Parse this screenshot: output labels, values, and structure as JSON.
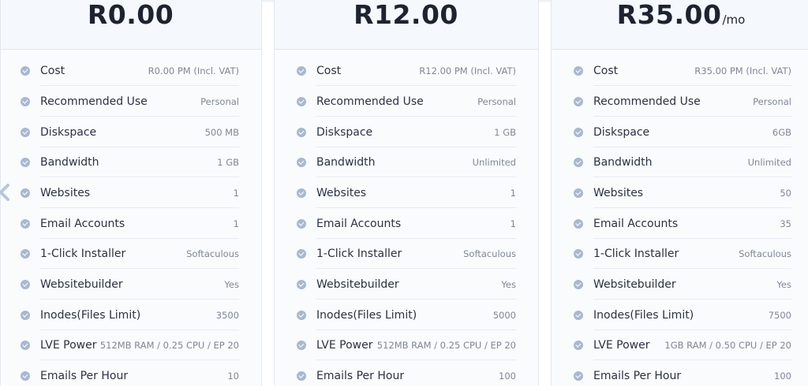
{
  "plans": [
    {
      "price": "R0.00",
      "per": "",
      "features": [
        {
          "label": "Cost",
          "value": "R0.00 PM (Incl. VAT)"
        },
        {
          "label": "Recommended Use",
          "value": "Personal"
        },
        {
          "label": "Diskspace",
          "value": "500 MB"
        },
        {
          "label": "Bandwidth",
          "value": "1 GB"
        },
        {
          "label": "Websites",
          "value": "1"
        },
        {
          "label": "Email Accounts",
          "value": "1"
        },
        {
          "label": "1-Click Installer",
          "value": "Softaculous"
        },
        {
          "label": "Websitebuilder",
          "value": "Yes"
        },
        {
          "label": "Inodes(Files Limit)",
          "value": "3500"
        },
        {
          "label": "LVE Power",
          "value": "512MB RAM / 0.25 CPU / EP 20"
        },
        {
          "label": "Emails Per Hour",
          "value": "10"
        }
      ]
    },
    {
      "price": "R12.00",
      "per": "",
      "features": [
        {
          "label": "Cost",
          "value": "R12.00 PM (Incl. VAT)"
        },
        {
          "label": "Recommended Use",
          "value": "Personal"
        },
        {
          "label": "Diskspace",
          "value": "1 GB"
        },
        {
          "label": "Bandwidth",
          "value": "Unlimited"
        },
        {
          "label": "Websites",
          "value": "1"
        },
        {
          "label": "Email Accounts",
          "value": "1"
        },
        {
          "label": "1-Click Installer",
          "value": "Softaculous"
        },
        {
          "label": "Websitebuilder",
          "value": "Yes"
        },
        {
          "label": "Inodes(Files Limit)",
          "value": "5000"
        },
        {
          "label": "LVE Power",
          "value": "512MB RAM / 0.25 CPU / EP 20"
        },
        {
          "label": "Emails Per Hour",
          "value": "100"
        }
      ]
    },
    {
      "price": "R35.00",
      "per": "/mo",
      "features": [
        {
          "label": "Cost",
          "value": "R35.00 PM (Incl. VAT)"
        },
        {
          "label": "Recommended Use",
          "value": "Personal"
        },
        {
          "label": "Diskspace",
          "value": "6GB"
        },
        {
          "label": "Bandwidth",
          "value": "Unlimited"
        },
        {
          "label": "Websites",
          "value": "50"
        },
        {
          "label": "Email Accounts",
          "value": "35"
        },
        {
          "label": "1-Click Installer",
          "value": "Softaculous"
        },
        {
          "label": "Websitebuilder",
          "value": "Yes"
        },
        {
          "label": "Inodes(Files Limit)",
          "value": "7500"
        },
        {
          "label": "LVE Power",
          "value": "1GB RAM / 0.50 CPU / EP 20"
        },
        {
          "label": "Emails Per Hour",
          "value": "100"
        }
      ]
    }
  ],
  "icons": {
    "feature": "check-circle-icon",
    "carousel": "chevron-left-icon"
  },
  "colors": {
    "check": "#a8b9cf",
    "card_bg": "#f5f8fc",
    "price": "#1d2330",
    "value": "#7f8795"
  }
}
